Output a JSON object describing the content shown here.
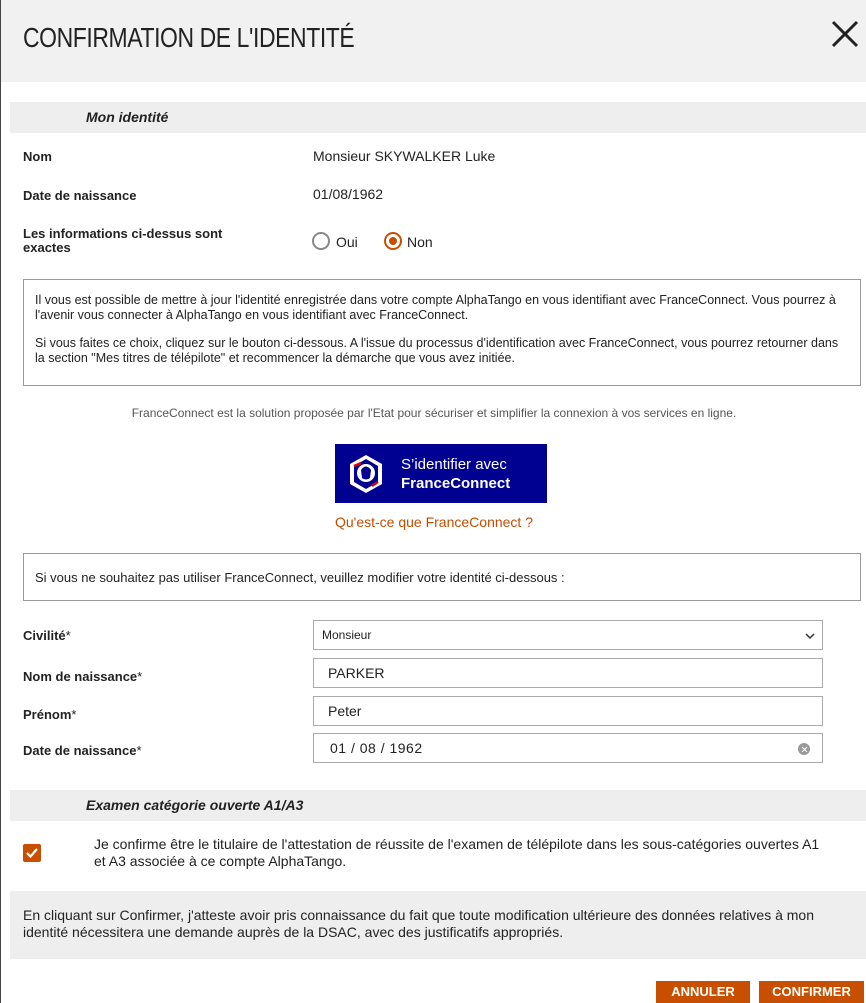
{
  "dialog": {
    "title": "CONFIRMATION DE L'IDENTITÉ"
  },
  "identity": {
    "section_title": "Mon identité",
    "name_label": "Nom",
    "name_value": "Monsieur SKYWALKER Luke",
    "dob_label": "Date de naissance",
    "dob_value": "01/08/1962",
    "exact_label": "Les informations ci-dessus sont exactes",
    "radio_yes": "Oui",
    "radio_no": "Non",
    "selected": "Non"
  },
  "info": {
    "p1": "Il vous est possible de mettre à jour l'identité enregistrée dans votre compte AlphaTango en vous identifiant avec FranceConnect. Vous pourrez à l'avenir vous connecter à AlphaTango en vous identifiant avec FranceConnect.",
    "p2": "Si vous faites ce choix, cliquez sur le bouton ci-dessous. A l'issue du processus d'identification avec FranceConnect, vous pourrez retourner dans la section \"Mes titres de télépilote\" et recommencer la démarche que vous avez initiée."
  },
  "franceconnect": {
    "description": "FranceConnect est la solution proposée par l'Etat pour sécuriser et simplifier la connexion à vos services en ligne.",
    "button_line1": "S’identifier avec",
    "button_line2": "FranceConnect",
    "link": "Qu'est-ce que FranceConnect ?"
  },
  "modify_notice": "Si vous ne souhaitez pas utiliser FranceConnect, veuillez modifier votre identité ci-dessous :",
  "form": {
    "civility_label": "Civilité",
    "civility_value": "Monsieur",
    "birthname_label": "Nom de naissance",
    "birthname_value": "PARKER",
    "firstname_label": "Prénom",
    "firstname_value": "Peter",
    "dob_label": "Date de naissance",
    "dob_value": "01 / 08 / 1962",
    "required_mark": "*"
  },
  "exam": {
    "section_title": "Examen catégorie ouverte A1/A3",
    "checked": true,
    "confirm_text": "Je confirme être le titulaire de l'attestation de réussite de l'examen de télépilote dans les sous-catégories ouvertes A1 et A3 associée à ce compte AlphaTango."
  },
  "notice": "En cliquant sur Confirmer, j'atteste avoir pris connaissance du fait que toute modification ultérieure des données relatives à mon identité nécessitera une demande auprès de la DSAC, avec des justificatifs appropriés.",
  "buttons": {
    "cancel": "ANNULER",
    "confirm": "CONFIRMER"
  },
  "colors": {
    "accent": "#c94f00",
    "franceconnect_blue": "#000091",
    "section_bg": "#eeeeee"
  }
}
